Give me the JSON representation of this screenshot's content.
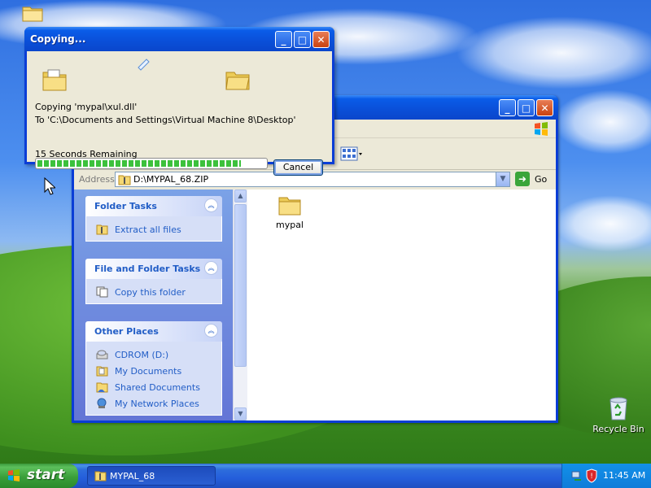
{
  "desktop": {
    "recycle_bin_label": "Recycle Bin"
  },
  "copy_dialog": {
    "title": "Copying...",
    "copying_line": "Copying 'mypal\\xul.dll'",
    "to_line": "To 'C:\\Documents and Settings\\Virtual Machine 8\\Desktop'",
    "remaining": "15 Seconds Remaining",
    "cancel_label": "Cancel",
    "progress": 0.88
  },
  "explorer": {
    "address_label": "Address",
    "address_value": "D:\\MYPAL_68.ZIP",
    "go_label": "Go",
    "panels": [
      {
        "title": "Folder Tasks",
        "items": [
          {
            "label": "Extract all files",
            "icon": "extract-icon"
          }
        ]
      },
      {
        "title": "File and Folder Tasks",
        "items": [
          {
            "label": "Copy this folder",
            "icon": "copy-icon"
          }
        ]
      },
      {
        "title": "Other Places",
        "items": [
          {
            "label": "CDROM (D:)",
            "icon": "cdrom-icon"
          },
          {
            "label": "My Documents",
            "icon": "documents-icon"
          },
          {
            "label": "Shared Documents",
            "icon": "shared-folder-icon"
          },
          {
            "label": "My Network Places",
            "icon": "network-icon"
          }
        ]
      }
    ],
    "files": [
      {
        "name": "mypal",
        "icon": "folder-icon"
      }
    ]
  },
  "taskbar": {
    "start_label": "start",
    "task_label": "MYPAL_68",
    "clock": "11:45 AM"
  },
  "colors": {
    "xp_blue": "#0a4fd8",
    "task_link": "#215dc6",
    "start_green": "#3a9f3a"
  }
}
